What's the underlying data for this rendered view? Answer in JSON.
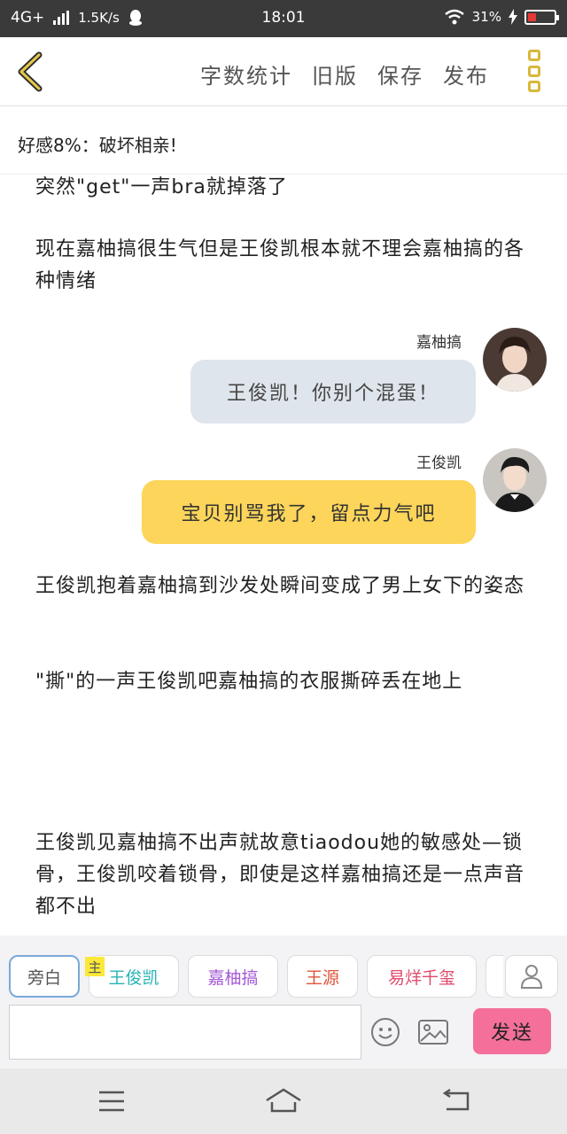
{
  "status_bar": {
    "network": "4G+",
    "speed": "1.5K/s",
    "time": "18:01",
    "battery": "31%",
    "battery_level": 0.31
  },
  "nav": {
    "actions": [
      "字数统计",
      "旧版",
      "保存",
      "发布"
    ]
  },
  "progress_text": "好感8%：破坏相亲!",
  "content": {
    "paragraphs_top": [
      "突然\"get\"一声bra就掉落了",
      "现在嘉柚搞很生气但是王俊凯根本就不理会嘉柚搞的各种情绪"
    ],
    "messages": [
      {
        "name": "嘉柚搞",
        "text": "王俊凯！你别个混蛋！",
        "color": "gray"
      },
      {
        "name": "王俊凯",
        "text": "宝贝别骂我了，留点力气吧",
        "color": "yellow"
      }
    ],
    "paragraphs_bottom": [
      "王俊凯抱着嘉柚搞到沙发处瞬间变成了男上女下的姿态",
      "\"撕\"的一声王俊凯吧嘉柚搞的衣服撕碎丢在地上",
      "王俊凯见嘉柚搞不出声就故意tiaodou她的敏感处—锁骨，王俊凯咬着锁骨，即使是这样嘉柚搞还是一点声音都不出"
    ]
  },
  "characters": [
    {
      "label": "旁白",
      "color": "#555555"
    },
    {
      "label": "王俊凯",
      "color": "#27b3b3"
    },
    {
      "label": "嘉柚搞",
      "color": "#a45ad6"
    },
    {
      "label": "王源",
      "color": "#e0533a"
    },
    {
      "label": "易烊千玺",
      "color": "#e04a6a"
    }
  ],
  "main_tag": "主",
  "input": {
    "value": "",
    "placeholder": ""
  },
  "send_label": "发送",
  "colors": {
    "accent_yellow": "#fcd55a",
    "send_pink": "#f4709a",
    "bubble_gray": "#dfe5ec"
  }
}
